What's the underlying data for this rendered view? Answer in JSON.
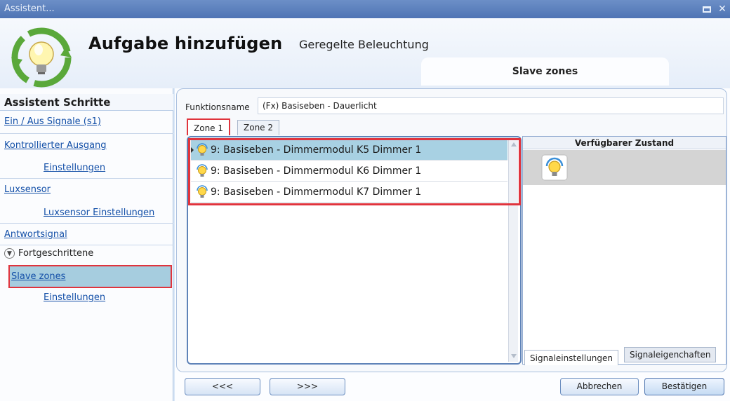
{
  "window": {
    "title": "Assistent..."
  },
  "header": {
    "title": "Aufgabe hinzufügen",
    "subtitle": "Geregelte Beleuchtung",
    "active_tab": "Slave zones"
  },
  "sidebar": {
    "heading": "Assistent Schritte",
    "items": [
      {
        "label": "Ein / Aus Signale (s1)"
      },
      {
        "label": "Kontrollierter Ausgang"
      },
      {
        "label": "Einstellungen"
      },
      {
        "label": "Luxsensor"
      },
      {
        "label": "Luxsensor Einstellungen"
      },
      {
        "label": "Antwortsignal"
      }
    ],
    "advanced_label": "Fortgeschrittene",
    "active_item": "Slave zones",
    "advanced_sub": "Einstellungen"
  },
  "form": {
    "function_label": "Funktionsname",
    "function_value": "(Fx) Basiseben - Dauerlicht"
  },
  "zones": {
    "tabs": [
      "Zone 1",
      "Zone 2"
    ],
    "rows": [
      "9: Basiseben - Dimmermodul K5 Dimmer 1",
      "9: Basiseben - Dimmermodul K6 Dimmer 1",
      "9: Basiseben - Dimmermodul K7 Dimmer 1"
    ]
  },
  "right_panel": {
    "heading": "Verfügbarer Zustand",
    "tabs": [
      "Signaleinstellungen",
      "Signaleigenchaften"
    ]
  },
  "buttons": {
    "back": "<<<",
    "next": ">>>",
    "cancel": "Abbrechen",
    "confirm": "Bestätigen"
  },
  "colors": {
    "accent": "#4f74b4",
    "highlight": "#a8d1e3",
    "annotation": "#e0343d",
    "link": "#1450a8"
  },
  "icons": [
    "light-bulb-cycle-logo",
    "light-bulb-icon",
    "maximize-icon",
    "close-icon",
    "chevron-down-icon"
  ]
}
